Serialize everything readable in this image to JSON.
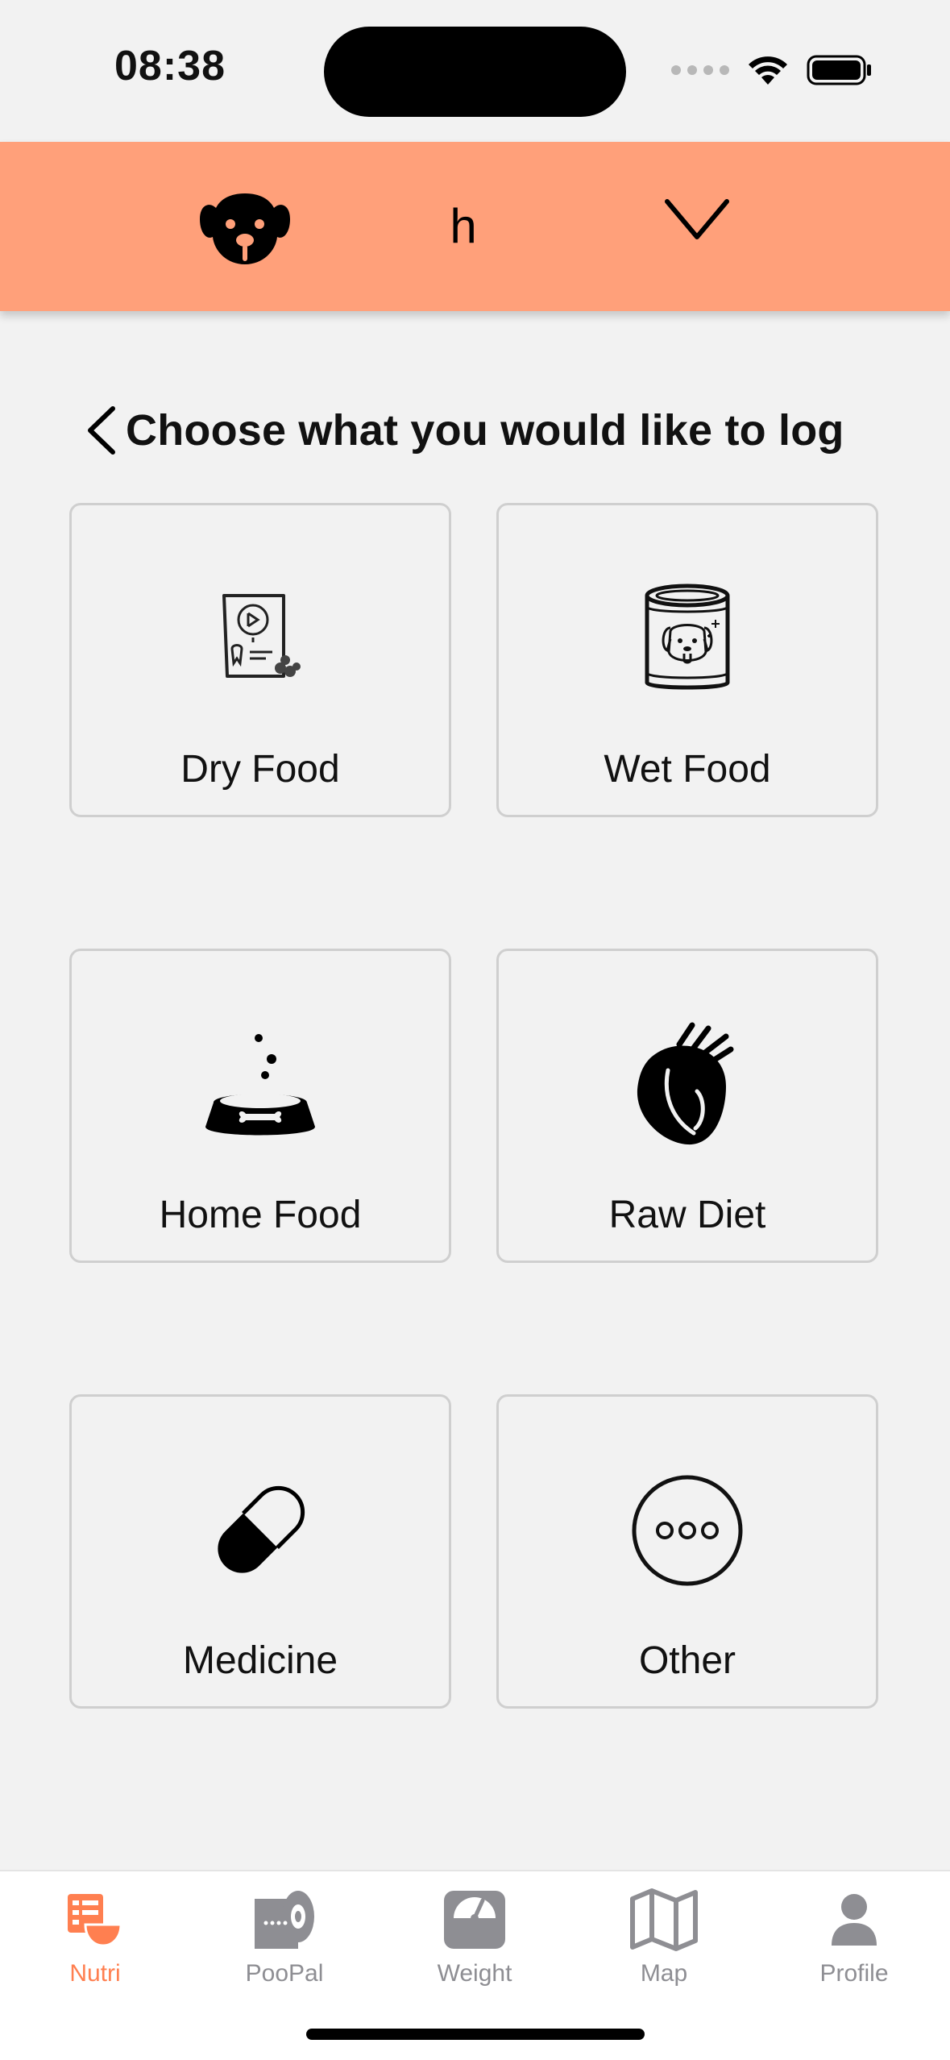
{
  "status": {
    "time": "08:38"
  },
  "header": {
    "pet_name": "h",
    "avatar_icon": "dog-face-icon",
    "dropdown_icon": "chevron-down-icon",
    "background_color": "#ffa07a"
  },
  "page": {
    "title": "Choose what you would like to log",
    "back_icon": "chevron-left-icon"
  },
  "cards": [
    {
      "label": "Dry Food",
      "icon": "dry-food-bag-icon"
    },
    {
      "label": "Wet Food",
      "icon": "wet-food-can-icon"
    },
    {
      "label": "Home Food",
      "icon": "dog-bowl-icon"
    },
    {
      "label": "Raw Diet",
      "icon": "raw-meat-icon"
    },
    {
      "label": "Medicine",
      "icon": "pill-icon"
    },
    {
      "label": "Other",
      "icon": "more-dots-icon"
    }
  ],
  "tabs": [
    {
      "label": "Nutri",
      "icon": "nutri-icon",
      "active": true
    },
    {
      "label": "PooPal",
      "icon": "poopal-roll-icon",
      "active": false
    },
    {
      "label": "Weight",
      "icon": "scale-icon",
      "active": false
    },
    {
      "label": "Map",
      "icon": "map-icon",
      "active": false
    },
    {
      "label": "Profile",
      "icon": "person-icon",
      "active": false
    }
  ],
  "colors": {
    "accent": "#ff7f50",
    "inactive_tab": "#8e8e93",
    "background": "#f2f2f2"
  }
}
